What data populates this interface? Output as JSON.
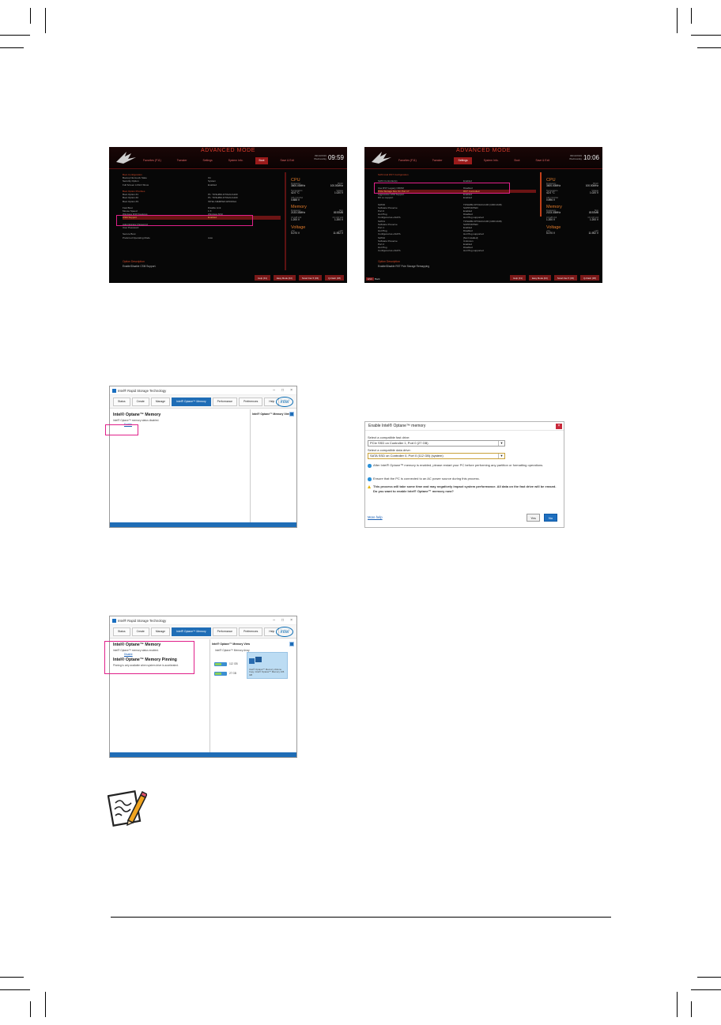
{
  "bios_a": {
    "mode_title": "ADVANCED MODE",
    "tabs": [
      "Favorites (F11)",
      "Tweaker",
      "Settings",
      "System Info.",
      "Boot",
      "Save & Exit"
    ],
    "active_tab": 4,
    "date": "09/13/2019",
    "day": "Wednesday",
    "time": "09:59",
    "rows": [
      {
        "k": "Boot Configuration",
        "v": "",
        "type": "sec"
      },
      {
        "k": "Bootup NumLock State",
        "v": "On",
        "type": ""
      },
      {
        "k": "Security Option",
        "v": "System",
        "type": ""
      },
      {
        "k": "Full Screen LOGO Show",
        "v": "Enabled",
        "type": ""
      },
      {
        "k": "",
        "v": "",
        "type": "gap"
      },
      {
        "k": "Boot Option Priorities",
        "v": "",
        "type": "sec"
      },
      {
        "k": "Boot Option #1",
        "v": "P1: TOSHIBA DT01ACA100",
        "type": ""
      },
      {
        "k": "Boot Option #2",
        "v": "P1: TOSHIBA DT01ACA100",
        "type": ""
      },
      {
        "k": "Boot Option #3",
        "v": "INTEL MEMPEK1W016GA",
        "type": ""
      },
      {
        "k": "",
        "v": "",
        "type": "gap"
      },
      {
        "k": "Fast Boot",
        "v": "Disable Link",
        "type": ""
      },
      {
        "k": "Mouse Speed",
        "v": "1 X",
        "type": ""
      },
      {
        "k": "Windows 8/10 Features",
        "v": "Windows 8/10",
        "type": ""
      },
      {
        "k": "CSM Support",
        "v": "Enabled",
        "type": "sel"
      },
      {
        "k": "",
        "v": "",
        "type": "gap"
      },
      {
        "k": "Administrator Password",
        "v": "",
        "type": ""
      },
      {
        "k": "User Password",
        "v": "",
        "type": ""
      },
      {
        "k": "",
        "v": "",
        "type": "gap"
      },
      {
        "k": "Secure Boot",
        "v": "",
        "type": ""
      },
      {
        "k": "Preferred Operating Mode",
        "v": "Auto",
        "type": ""
      }
    ],
    "desc_title": "Option Description",
    "desc_text": "Enable/Disable CSM Support.",
    "buttons": [
      "Help (F1)",
      "Easy Mode (F2)",
      "Smart Fan 5 (F6)",
      "Q-Flash (F8)"
    ],
    "monitor": {
      "cpu_label": "CPU",
      "freq_label": "Frequency",
      "bclk_label": "BCLK",
      "freq": "3600.00MHz",
      "bclk": "100.00MHz",
      "temp_label": "Temperature",
      "volt_label": "Voltage",
      "temp": "42.0 °C",
      "volt": "1.020 V",
      "vcore_label": "CPU VCCSA",
      "vcore": "0.888 V",
      "mem_label": "Memory",
      "mfreq_label": "Frequency",
      "size_label": "Size",
      "mfreq": "2133.33MHz",
      "size": "8192MB",
      "cha_label": "Ch A/B Volt",
      "chc_label": "Ch C/D Volt",
      "cha": "1.200 V",
      "chc": "1.200 V",
      "volt_head": "Voltage",
      "v5_label": "+5V",
      "v12_label": "+12V",
      "v5": "5.070 V",
      "v12": "11.952 V"
    }
  },
  "bios_b": {
    "mode_title": "ADVANCED MODE",
    "tabs": [
      "Favorites (F11)",
      "Tweaker",
      "Settings",
      "System Info.",
      "Boot",
      "Save & Exit"
    ],
    "active_tab": 2,
    "date": "09/13/2019",
    "day": "Wednesday",
    "time": "10:06",
    "rows": [
      {
        "k": "SATA And RST Configuration",
        "v": "",
        "type": "sec"
      },
      {
        "k": "",
        "v": "",
        "type": "gap"
      },
      {
        "k": "SATA Controller(s)",
        "v": "Enabled",
        "type": ""
      },
      {
        "k": "",
        "v": "",
        "type": "gap"
      },
      {
        "k": "Use RST Legacy OROM",
        "v": "Disabled",
        "type": ""
      },
      {
        "k": "PCIe Storage Dev On Port 17",
        "v": "RST Controlled",
        "type": "sel"
      },
      {
        "k": "Aggressive LPM Support",
        "v": "Enabled",
        "type": ""
      },
      {
        "k": "RX Lo support",
        "v": "Enabled",
        "type": ""
      },
      {
        "k": "",
        "v": "",
        "type": "gap"
      },
      {
        "k": "SATA0",
        "v": "TOSHIBA DT01ACA100 (1000.2GB)",
        "type": ""
      },
      {
        "k": "Software Preserve",
        "v": "SUPPORTED",
        "type": ""
      },
      {
        "k": "Port 0",
        "v": "Enabled",
        "type": ""
      },
      {
        "k": "Hot Plug",
        "v": "Disabled",
        "type": ""
      },
      {
        "k": "Configured as eSATA",
        "v": "Hot Plug supported",
        "type": ""
      },
      {
        "k": "SATA1",
        "v": "TOSHIBA DT01ACA100 (1000.2GB)",
        "type": ""
      },
      {
        "k": "Software Preserve",
        "v": "SUPPORTED",
        "type": ""
      },
      {
        "k": "Port 1",
        "v": "Enabled",
        "type": ""
      },
      {
        "k": "Hot Plug",
        "v": "Disabled",
        "type": ""
      },
      {
        "k": "Configured as eSATA",
        "v": "Hot Plug supported",
        "type": ""
      },
      {
        "k": "SATA2",
        "v": "[Not Installed]",
        "type": ""
      },
      {
        "k": "Software Preserve",
        "v": "Unknown",
        "type": ""
      },
      {
        "k": "Port 2",
        "v": "Enabled",
        "type": ""
      },
      {
        "k": "Hot Plug",
        "v": "Disabled",
        "type": ""
      },
      {
        "k": "Configured as eSATA",
        "v": "Hot Plug supported",
        "type": ""
      }
    ],
    "desc_title": "Option Description",
    "desc_text": "Enable/Disable RST Pcie Storage Remapping",
    "buttons": [
      "Help (F1)",
      "Easy Mode (F2)",
      "Smart Fan 5 (F6)",
      "Q-Flash (F8)"
    ],
    "esc_key": "ESC",
    "esc_text": "Back",
    "monitor": {
      "cpu_label": "CPU",
      "freq_label": "Frequency",
      "bclk_label": "BCLK",
      "freq": "3600.00MHz",
      "bclk": "100.00MHz",
      "temp_label": "Temperature",
      "volt_label": "Voltage",
      "temp": "42.0 °C",
      "volt": "1.020 V",
      "vcore_label": "CPU VCCSA",
      "vcore": "0.896 V",
      "mem_label": "Memory",
      "mfreq_label": "Frequency",
      "size_label": "Size",
      "mfreq": "2133.33MHz",
      "size": "8192MB",
      "cha_label": "Ch A/B Volt",
      "chc_label": "Ch C/D Volt",
      "cha": "1.200 V",
      "chc": "1.200 V",
      "volt_head": "Voltage",
      "v5_label": "+5V",
      "v12_label": "+12V",
      "v5": "5.070 V",
      "v12": "11.952 V"
    }
  },
  "rst_a": {
    "title": "Intel® Rapid Storage Technology",
    "tabs": [
      "Status",
      "Create",
      "Manage",
      "Intel® Optane™ Memory",
      "Performance",
      "Preferences",
      "Help"
    ],
    "active_tab": 3,
    "brand": "intel",
    "heading": "Intel® Optane™ Memory",
    "status": "Intel® Optane™ memory status disabled.",
    "link": "Enable",
    "right_title": "Intel® Optane™ Memory View"
  },
  "dialog": {
    "title": "Enable Intel® Optane™ memory",
    "fast_label": "Select a compatible fast drive:",
    "fast_value": "PCIe SSD on Controller 1, Port 0 (27 GB)",
    "data_label": "Select a compatible data drive:",
    "data_value": "SATA SSD on Controller 0, Port 0 (112 GB) (system)",
    "note1": "After Intel® Optane™ memory is enabled, please restart your PC before performing any partition or formatting operations.",
    "note2": "Ensure that the PC is connected to an AC power source during this process.",
    "warning": "This process will take some time and may negatively impact system performance. All data on the fast drive will be erased. Do you want to enable Intel® Optane™ memory now?",
    "more_help": "More help",
    "yes": "Yes",
    "no": "No"
  },
  "rst_b": {
    "title": "Intel® Rapid Storage Technology",
    "tabs": [
      "Status",
      "Create",
      "Manage",
      "Intel® Optane™ Memory",
      "Performance",
      "Preferences",
      "Help"
    ],
    "active_tab": 3,
    "brand": "intel",
    "heading": "Intel® Optane™ Memory",
    "status": "Intel® Optane™ memory status enabled.",
    "link": "Disable",
    "heading2": "Intel® Optane™ Memory Pinning",
    "pin_text": "Pinning is only available when system drive is accelerated.",
    "right_title": "Intel® Optane™ Memory View",
    "right_sub": "Intel® Optane™ Memory Array",
    "drive1": "112 GB",
    "drive2": "27 GB",
    "tooltip": "Intel® Optane™ Memory Volume Copy. Intel® Optane™ Memory 136 GB"
  }
}
